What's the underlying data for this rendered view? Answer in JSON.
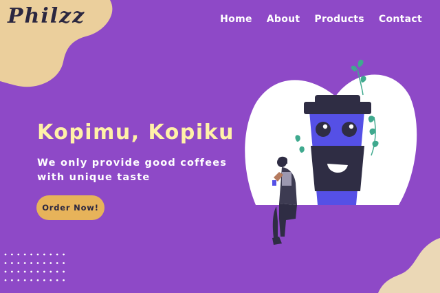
{
  "brand": {
    "logo": "Philzz"
  },
  "nav": {
    "items": [
      {
        "label": "Home"
      },
      {
        "label": "About"
      },
      {
        "label": "Products"
      },
      {
        "label": "Contact"
      }
    ]
  },
  "hero": {
    "title": "Kopimu, Kopiku",
    "subtitle_line1": "We only provide good coffees",
    "subtitle_line2": "with unique taste",
    "cta_label": "Order Now!"
  },
  "colors": {
    "background": "#8E49C7",
    "blob": "#EBCF9C",
    "title": "#FFF1A8",
    "button": "#E7B35A",
    "cup": "#5550E6",
    "cup_lid": "#2F2D44"
  },
  "icons": {
    "illustration": "coffee-cup-mascot-with-person"
  }
}
